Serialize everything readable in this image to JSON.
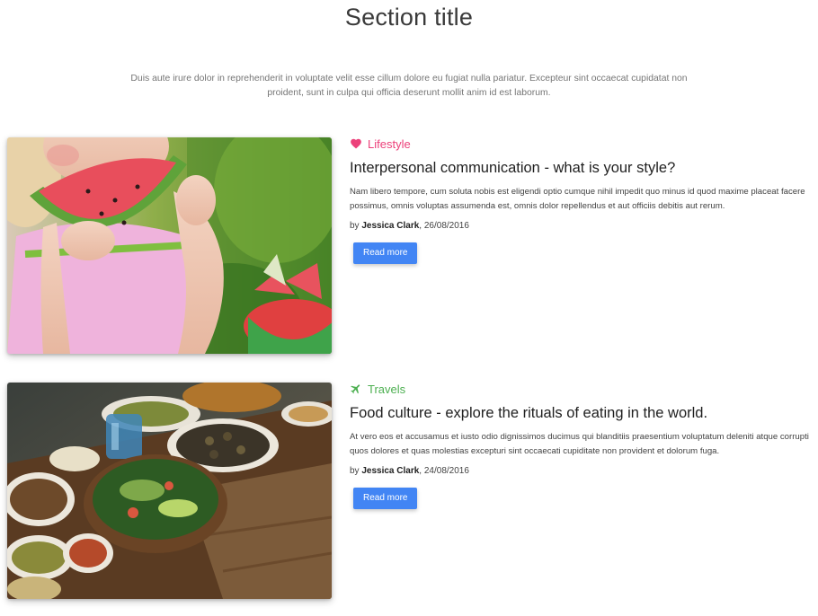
{
  "section": {
    "title": "Section title",
    "description": "Duis aute irure dolor in reprehenderit in voluptate velit esse cillum dolore eu fugiat nulla pariatur. Excepteur sint occaecat cupidatat non proident, sunt in culpa qui officia deserunt mollit anim id est laborum."
  },
  "posts": [
    {
      "category": "Lifestyle",
      "category_icon": "heart-icon",
      "category_color": "#ec407a",
      "title": "Interpersonal communication - what is your style?",
      "excerpt": "Nam libero tempore, cum soluta nobis est eligendi optio cumque nihil impedit quo minus id quod maxime placeat facere possimus, omnis voluptas assumenda est, omnis dolor repellendus et aut officiis debitis aut rerum.",
      "by": "by ",
      "author": "Jessica Clark",
      "date": ", 26/08/2016",
      "button": "Read more"
    },
    {
      "category": "Travels",
      "category_icon": "plane-icon",
      "category_color": "#4caf50",
      "title": "Food culture - explore the rituals of eating in the world.",
      "excerpt": "At vero eos et accusamus et iusto odio dignissimos ducimus qui blanditiis praesentium voluptatum deleniti atque corrupti quos dolores et quas molestias excepturi sint occaecati cupiditate non provident et dolorum fuga.",
      "by": "by ",
      "author": "Jessica Clark",
      "date": ", 24/08/2016",
      "button": "Read more"
    }
  ],
  "colors": {
    "button": "#4285f4",
    "lifestyle": "#ec407a",
    "travels": "#4caf50"
  }
}
